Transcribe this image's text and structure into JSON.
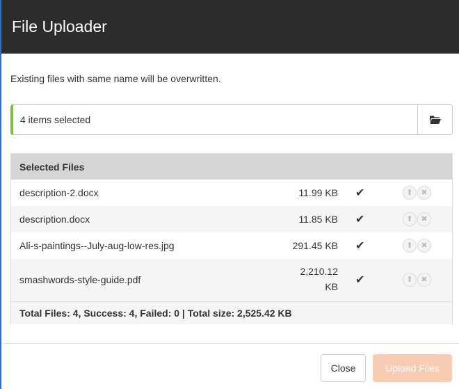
{
  "dialog": {
    "title": "File Uploader",
    "notice": "Existing files with same name will be overwritten."
  },
  "file_input": {
    "value": "4 items selected",
    "browse_icon": "folder-open-icon",
    "accent_color": "#7dbf3b"
  },
  "table": {
    "header": "Selected Files",
    "rows": [
      {
        "name": "description-2.docx",
        "size": "11.99 KB",
        "status_icon": "check-icon"
      },
      {
        "name": "description.docx",
        "size": "11.85 KB",
        "status_icon": "check-icon"
      },
      {
        "name": "Ali-s-paintings--July-aug-low-res.jpg",
        "size": "291.45 KB",
        "status_icon": "check-icon"
      },
      {
        "name": "smashwords-style-guide.pdf",
        "size_line1": "2,210.12",
        "size_line2": "KB",
        "status_icon": "check-icon"
      }
    ],
    "summary": "Total Files: 4, Success: 4, Failed: 0 | Total size: 2,525.42 KB"
  },
  "buttons": {
    "close": "Close",
    "upload": "Upload Files",
    "upload_color": "#f8cbb3"
  }
}
